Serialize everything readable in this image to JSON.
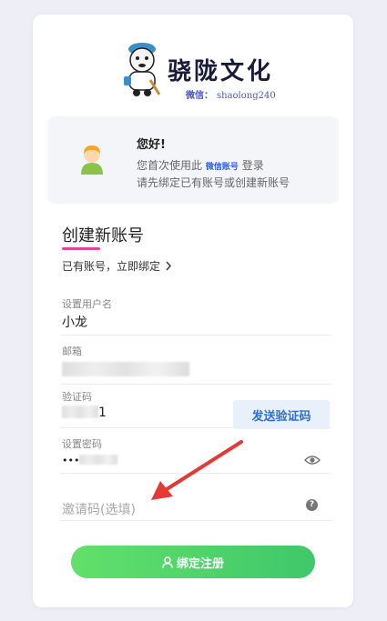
{
  "logo": {
    "title": "骁陇文化",
    "wechat_label": "微信：",
    "wechat_account": "shaolong240"
  },
  "greeting": {
    "title": "您好!",
    "line1_prefix": "您首次使用此",
    "line1_badge": "微信账号",
    "line1_suffix": "登录",
    "line2": "请先绑定已有账号或创建新账号"
  },
  "form": {
    "title": "创建新账号",
    "login_link": "已有账号，立即绑定",
    "login_link_icon": "chevron-right-icon",
    "username_label": "设置用户名",
    "username_value": "小龙",
    "email_label": "邮箱",
    "code_label": "验证码",
    "code_visible_suffix": "1",
    "send_code_label": "发送验证码",
    "password_label": "设置密码",
    "password_mask": "•••",
    "invite_placeholder": "邀请码(选填)",
    "submit_label": "绑定注册"
  },
  "colors": {
    "accent_pink": "#e0449a",
    "button_green": "#4cd26a",
    "send_button_bg": "#e7f0fb",
    "send_button_text": "#2e6fd0",
    "annotation_arrow": "#e53935"
  }
}
